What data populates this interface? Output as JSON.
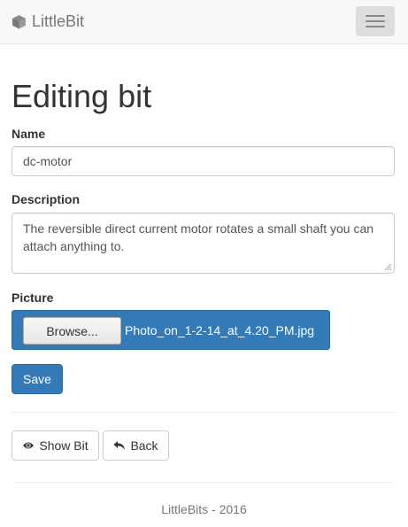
{
  "navbar": {
    "brand": "LittleBit",
    "brand_icon": "cube-icon",
    "toggle_icon": "hamburger-menu-icon"
  },
  "page": {
    "title": "Editing bit"
  },
  "form": {
    "name_label": "Name",
    "name_value": "dc-motor",
    "description_label": "Description",
    "description_value": "The reversible direct current motor rotates a small shaft you can attach anything to.",
    "picture_label": "Picture",
    "browse_label": "Browse...",
    "file_name": "Photo_on_1-2-14_at_4.20_PM.jpg",
    "save_label": "Save"
  },
  "actions": {
    "show_label": "Show Bit",
    "show_icon": "eye-icon",
    "back_label": "Back",
    "back_icon": "back-arrow-icon"
  },
  "footer": {
    "text": "LittleBits - 2016"
  },
  "colors": {
    "primary": "#337ab7",
    "navbar_bg": "#f8f8f8",
    "toggle_bg": "#dddddd"
  }
}
